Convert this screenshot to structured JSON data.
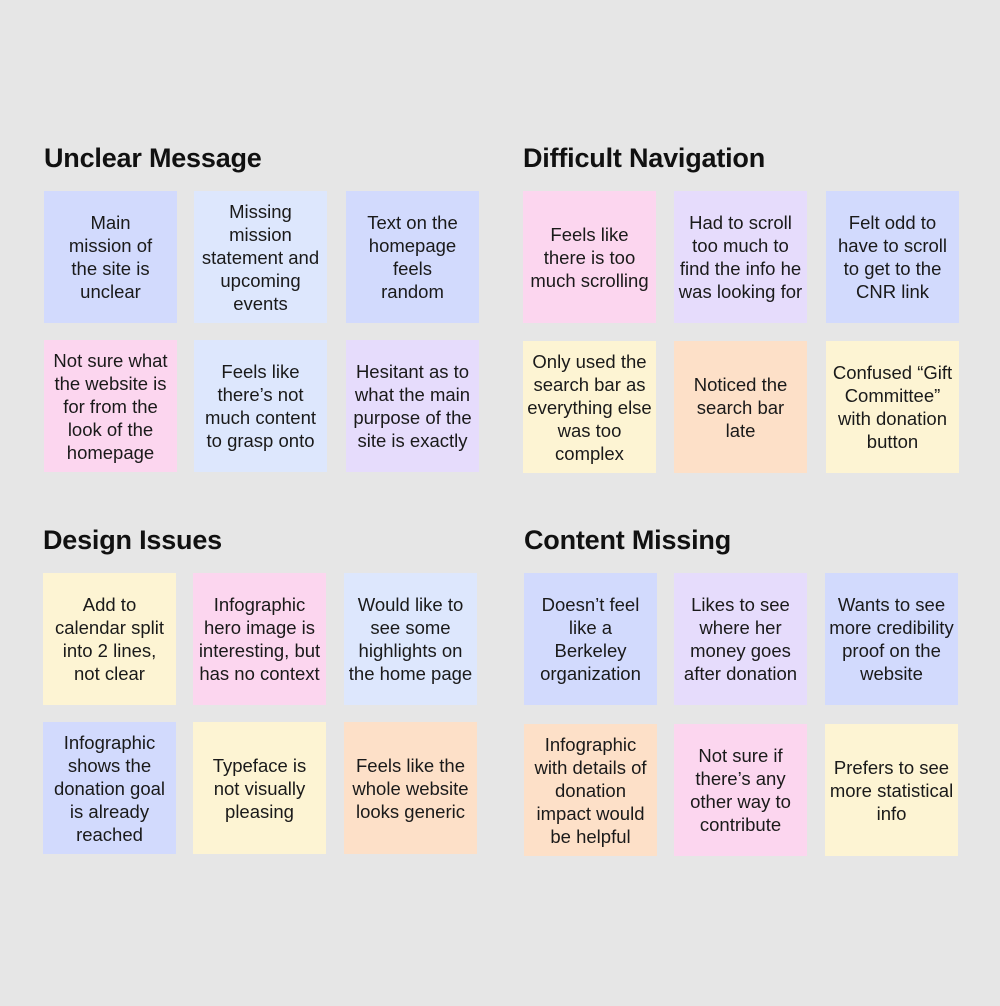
{
  "colors": {
    "background": "#e6e6e6",
    "blue": "#d2dafd",
    "light_blue": "#dde7fd",
    "lavender": "#e6dcfc",
    "pink": "#fcd6ef",
    "yellow": "#fdf4d3",
    "peach": "#fde0c8"
  },
  "groups": [
    {
      "title": "Unclear Message",
      "notes": [
        {
          "text": "Main mission of the site is unclear",
          "color": "#d2dafd"
        },
        {
          "text": "Missing mission statement and upcoming events",
          "color": "#dde7fd"
        },
        {
          "text": "Text on the homepage feels random",
          "color": "#d2dafd"
        },
        {
          "text": "Not sure what the website is for from the look of the homepage",
          "color": "#fcd6ef"
        },
        {
          "text": "Feels like there’s not much content to grasp onto",
          "color": "#dde7fd"
        },
        {
          "text": "Hesitant as to what the main purpose of the site is exactly",
          "color": "#e6dcfc"
        }
      ]
    },
    {
      "title": "Difficult Navigation",
      "notes": [
        {
          "text": "Feels like there is too much scrolling",
          "color": "#fcd6ef"
        },
        {
          "text": "Had to scroll too much to find the info he was looking for",
          "color": "#e6dcfc"
        },
        {
          "text": "Felt odd to have to scroll to get to the CNR link",
          "color": "#d2dafd"
        },
        {
          "text": "Only used the search bar as everything else was too complex",
          "color": "#fdf4d3"
        },
        {
          "text": "Noticed the search bar late",
          "color": "#fde0c8"
        },
        {
          "text": "Confused “Gift Committee” with donation button",
          "color": "#fdf4d3"
        }
      ]
    },
    {
      "title": "Design Issues",
      "notes": [
        {
          "text": "Add to calendar split into 2 lines, not clear",
          "color": "#fdf4d3"
        },
        {
          "text": "Infographic hero image is interesting, but has no context",
          "color": "#fcd6ef"
        },
        {
          "text": "Would like to see some highlights on the home page",
          "color": "#dde7fd"
        },
        {
          "text": "Infographic shows the donation goal is already reached",
          "color": "#d2dafd"
        },
        {
          "text": "Typeface is not visually pleasing",
          "color": "#fdf4d3"
        },
        {
          "text": "Feels like the whole website looks generic",
          "color": "#fde0c8"
        }
      ]
    },
    {
      "title": "Content Missing",
      "notes": [
        {
          "text": "Doesn’t feel like a Berkeley organization",
          "color": "#d2dafd"
        },
        {
          "text": "Likes to see where her money goes after donation",
          "color": "#e6dcfc"
        },
        {
          "text": "Wants to see more credibility proof on the website",
          "color": "#d2dafd"
        },
        {
          "text": "Infographic with details of donation impact would be helpful",
          "color": "#fde0c8"
        },
        {
          "text": "Not sure if there’s any other way to contribute",
          "color": "#fcd6ef"
        },
        {
          "text": "Prefers to see more statistical info",
          "color": "#fdf4d3"
        }
      ]
    }
  ]
}
